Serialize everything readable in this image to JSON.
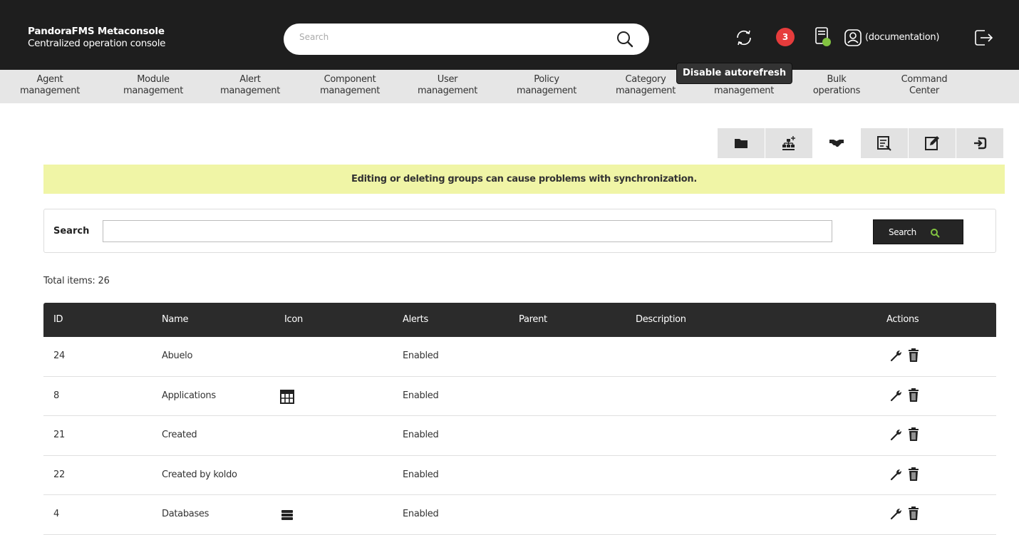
{
  "header": {
    "brand_title": "PandoraFMS Metaconsole",
    "brand_subtitle": "Centralized operation console",
    "search_placeholder": "Search",
    "notification_count": "3",
    "user_label": "(documentation)",
    "tooltip": "Disable autorefresh"
  },
  "menu": [
    {
      "line1": "Agent",
      "line2": "management"
    },
    {
      "line1": "Module",
      "line2": "management"
    },
    {
      "line1": "Alert",
      "line2": "management"
    },
    {
      "line1": "Component",
      "line2": "management"
    },
    {
      "line1": "User",
      "line2": "management"
    },
    {
      "line1": "Policy",
      "line2": "management"
    },
    {
      "line1": "Category",
      "line2": "management"
    },
    {
      "line1": "",
      "line2": "management"
    },
    {
      "line1": "Bulk",
      "line2": "operations"
    },
    {
      "line1": "Command",
      "line2": "Center"
    }
  ],
  "tools": [
    "folder-icon",
    "group-add-icon",
    "handshake-icon",
    "list-icon",
    "edit-icon",
    "exit-icon"
  ],
  "warning": "Editing or deleting groups can cause problems with synchronization.",
  "search": {
    "label": "Search",
    "value": "",
    "button_label": "Search"
  },
  "total_items": "Total items: 26",
  "table": {
    "columns": [
      "ID",
      "Name",
      "Icon",
      "Alerts",
      "Parent",
      "Description",
      "Actions"
    ],
    "rows": [
      {
        "id": "24",
        "name": "Abuelo",
        "icon": "",
        "alerts": "Enabled",
        "parent": "",
        "description": ""
      },
      {
        "id": "8",
        "name": "Applications",
        "icon": "calculator-icon",
        "alerts": "Enabled",
        "parent": "",
        "description": ""
      },
      {
        "id": "21",
        "name": "Created",
        "icon": "",
        "alerts": "Enabled",
        "parent": "",
        "description": ""
      },
      {
        "id": "22",
        "name": "Created by koldo",
        "icon": "",
        "alerts": "Enabled",
        "parent": "",
        "description": ""
      },
      {
        "id": "4",
        "name": "Databases",
        "icon": "database-icon",
        "alerts": "Enabled",
        "parent": "",
        "description": ""
      }
    ]
  },
  "colors": {
    "header_bg": "#1e1e1e",
    "menu_bg": "#e6e6e6",
    "warning_bg": "#f0f5a6",
    "badge_red": "#e63c3c",
    "accent_green": "#82c341"
  }
}
